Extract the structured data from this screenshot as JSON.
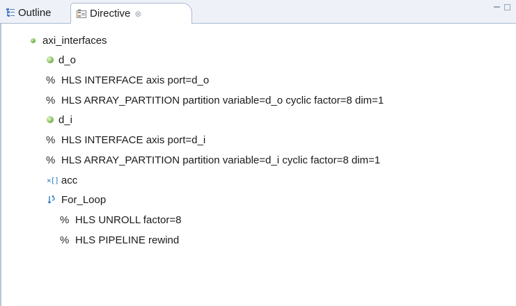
{
  "tabs": [
    {
      "label": "Outline",
      "icon": "outline-icon"
    },
    {
      "label": "Directive",
      "icon": "directive-icon",
      "close": "⊗"
    }
  ],
  "tree": {
    "function": "axi_interfaces",
    "items": [
      {
        "kind": "port",
        "text": "d_o"
      },
      {
        "kind": "directive",
        "prefix": "%",
        "text": "HLS INTERFACE axis port=d_o"
      },
      {
        "kind": "directive",
        "prefix": "%",
        "text": "HLS ARRAY_PARTITION partition variable=d_o cyclic factor=8 dim=1"
      },
      {
        "kind": "port",
        "text": "d_i"
      },
      {
        "kind": "directive",
        "prefix": "%",
        "text": "HLS INTERFACE axis port=d_i"
      },
      {
        "kind": "directive",
        "prefix": "%",
        "text": "HLS ARRAY_PARTITION partition variable=d_i cyclic factor=8 dim=1"
      },
      {
        "kind": "variable",
        "icon_text": "×[]",
        "text": "acc"
      },
      {
        "kind": "loop",
        "text": "For_Loop"
      },
      {
        "kind": "loop-directive",
        "prefix": "%",
        "text": "HLS UNROLL factor=8"
      },
      {
        "kind": "loop-directive",
        "prefix": "%",
        "text": "HLS PIPELINE rewind"
      }
    ]
  },
  "colors": {
    "tab_bg": "#eef2f8",
    "tab_border": "#a9b8cf",
    "port_icon": "#74b84a",
    "var_icon": "#2c7cc0"
  }
}
